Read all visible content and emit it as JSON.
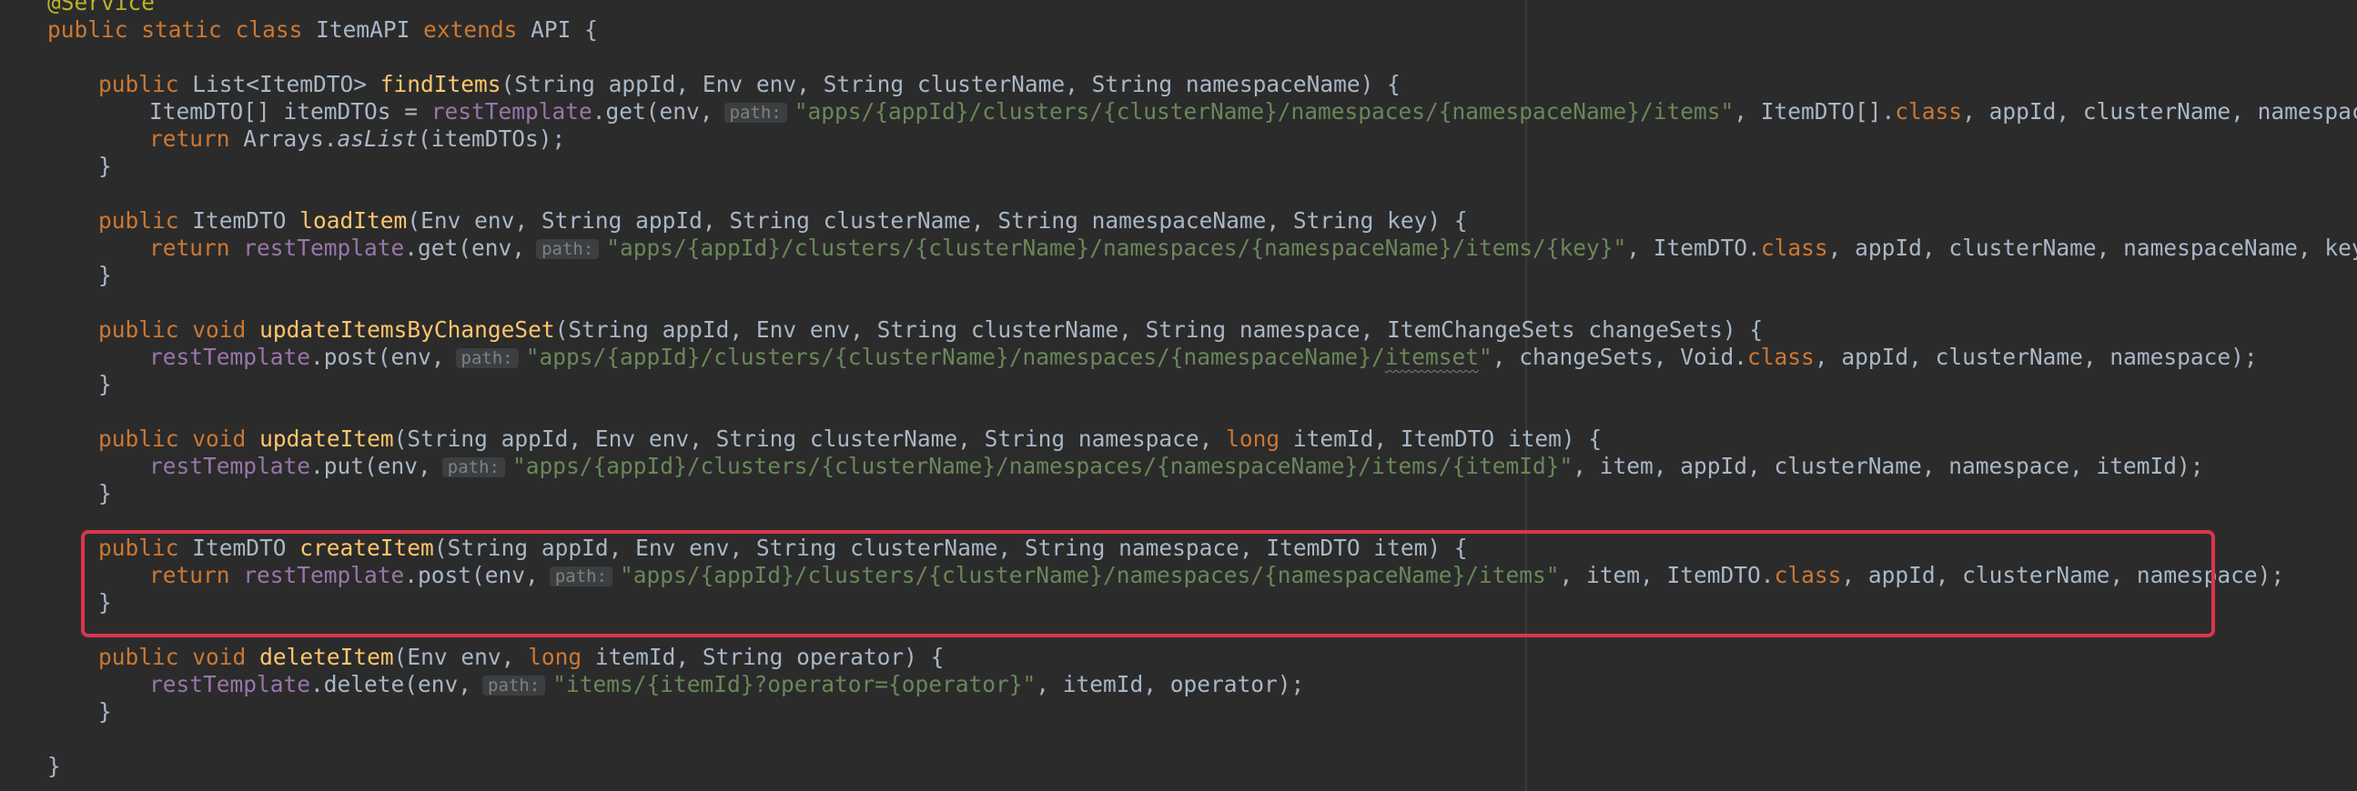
{
  "code": {
    "annotation": "@Service",
    "class_decl": {
      "kw1": "public",
      "kw2": "static",
      "kw3": "class",
      "name": "ItemAPI",
      "kw4": "extends",
      "parent": "API {"
    },
    "findItems": {
      "sig_kw": "public",
      "sig_type": "List<ItemDTO> ",
      "sig_name": "findItems",
      "sig_params": "(String appId, Env env, String clusterName, String namespaceName) {",
      "body1_a": "ItemDTO[] itemDTOs = ",
      "body1_field": "restTemplate",
      "body1_b": ".get(env,",
      "body1_hint": "path:",
      "body1_str": "\"apps/{appId}/clusters/{clusterName}/namespaces/{namespaceName}/items\"",
      "body1_c": ", ItemDTO[].",
      "body1_kw": "class",
      "body1_d": ", appId, clusterName, namespaceName);",
      "body2_kw": "return",
      "body2_a": " Arrays.",
      "body2_it": "asList",
      "body2_b": "(itemDTOs);",
      "close": "}"
    },
    "loadItem": {
      "sig_kw": "public",
      "sig_type": "ItemDTO ",
      "sig_name": "loadItem",
      "sig_params": "(Env env, String appId, String clusterName, String namespaceName, String key) {",
      "body_kw": "return",
      "body_field": "restTemplate",
      "body_a": ".get(env,",
      "body_hint": "path:",
      "body_str": "\"apps/{appId}/clusters/{clusterName}/namespaces/{namespaceName}/items/{key}\"",
      "body_b": ", ItemDTO.",
      "body_kw2": "class",
      "body_c": ", appId, clusterName, namespaceName, key);",
      "close": "}"
    },
    "updateItemsByChangeSet": {
      "sig_kw": "public",
      "sig_kw2": "void",
      "sig_name": "updateItemsByChangeSet",
      "sig_params": "(String appId, Env env, String clusterName, String namespace, ItemChangeSets changeSets) {",
      "body_field": "restTemplate",
      "body_a": ".post(env,",
      "body_hint": "path:",
      "body_str1": "\"apps/{appId}/clusters/{clusterName}/namespaces/{namespaceName}/",
      "body_str_sq": "itemset",
      "body_str2": "\"",
      "body_b": ", changeSets, Void.",
      "body_kw": "class",
      "body_c": ", appId, clusterName, namespace);",
      "close": "}"
    },
    "updateItem": {
      "sig_kw": "public",
      "sig_kw2": "void",
      "sig_name": "updateItem",
      "sig_params_a": "(String appId, Env env, String clusterName, String namespace, ",
      "sig_kw3": "long",
      "sig_params_b": " itemId, ItemDTO item) {",
      "body_field": "restTemplate",
      "body_a": ".put(env,",
      "body_hint": "path:",
      "body_str": "\"apps/{appId}/clusters/{clusterName}/namespaces/{namespaceName}/items/{itemId}\"",
      "body_b": ", item, appId, clusterName, namespace, itemId);",
      "close": "}"
    },
    "createItem": {
      "sig_kw": "public",
      "sig_type": "ItemDTO ",
      "sig_name": "createItem",
      "sig_params": "(String appId, Env env, String clusterName, String namespace, ItemDTO item) {",
      "body_kw": "return",
      "body_field": "restTemplate",
      "body_a": ".post(env,",
      "body_hint": "path:",
      "body_str": "\"apps/{appId}/clusters/{clusterName}/namespaces/{namespaceName}/items\"",
      "body_b": ", item, ItemDTO.",
      "body_kw2": "class",
      "body_c": ", appId, clusterName, namespace);",
      "close": "}"
    },
    "deleteItem": {
      "sig_kw": "public",
      "sig_kw2": "void",
      "sig_name": "deleteItem",
      "sig_params_a": "(Env env, ",
      "sig_kw3": "long",
      "sig_params_b": " itemId, String operator) {",
      "body_field": "restTemplate",
      "body_a": ".delete(env,",
      "body_hint": "path:",
      "body_str": "\"items/{itemId}?operator={operator}\"",
      "body_b": ", itemId, operator);",
      "close": "}"
    },
    "class_close": "}"
  },
  "colors": {
    "background": "#2b2b2b",
    "keyword": "#cc7832",
    "annotation": "#bbb529",
    "method": "#ffc66d",
    "field": "#9876aa",
    "string": "#6a8759",
    "highlight_border": "#d9364c"
  }
}
